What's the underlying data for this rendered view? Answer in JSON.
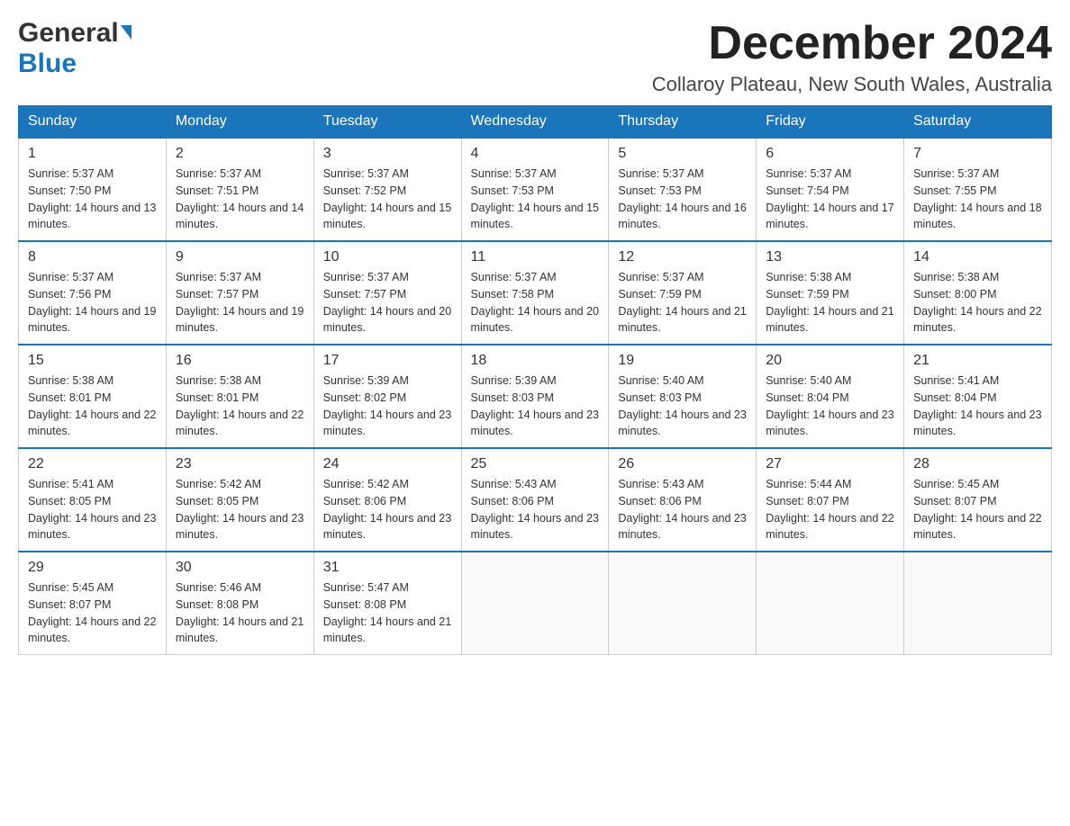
{
  "header": {
    "logo_general": "General",
    "logo_blue": "Blue",
    "month_title": "December 2024",
    "location": "Collaroy Plateau, New South Wales, Australia"
  },
  "calendar": {
    "days_of_week": [
      "Sunday",
      "Monday",
      "Tuesday",
      "Wednesday",
      "Thursday",
      "Friday",
      "Saturday"
    ],
    "weeks": [
      [
        {
          "day": "1",
          "sunrise": "Sunrise: 5:37 AM",
          "sunset": "Sunset: 7:50 PM",
          "daylight": "Daylight: 14 hours and 13 minutes."
        },
        {
          "day": "2",
          "sunrise": "Sunrise: 5:37 AM",
          "sunset": "Sunset: 7:51 PM",
          "daylight": "Daylight: 14 hours and 14 minutes."
        },
        {
          "day": "3",
          "sunrise": "Sunrise: 5:37 AM",
          "sunset": "Sunset: 7:52 PM",
          "daylight": "Daylight: 14 hours and 15 minutes."
        },
        {
          "day": "4",
          "sunrise": "Sunrise: 5:37 AM",
          "sunset": "Sunset: 7:53 PM",
          "daylight": "Daylight: 14 hours and 15 minutes."
        },
        {
          "day": "5",
          "sunrise": "Sunrise: 5:37 AM",
          "sunset": "Sunset: 7:53 PM",
          "daylight": "Daylight: 14 hours and 16 minutes."
        },
        {
          "day": "6",
          "sunrise": "Sunrise: 5:37 AM",
          "sunset": "Sunset: 7:54 PM",
          "daylight": "Daylight: 14 hours and 17 minutes."
        },
        {
          "day": "7",
          "sunrise": "Sunrise: 5:37 AM",
          "sunset": "Sunset: 7:55 PM",
          "daylight": "Daylight: 14 hours and 18 minutes."
        }
      ],
      [
        {
          "day": "8",
          "sunrise": "Sunrise: 5:37 AM",
          "sunset": "Sunset: 7:56 PM",
          "daylight": "Daylight: 14 hours and 19 minutes."
        },
        {
          "day": "9",
          "sunrise": "Sunrise: 5:37 AM",
          "sunset": "Sunset: 7:57 PM",
          "daylight": "Daylight: 14 hours and 19 minutes."
        },
        {
          "day": "10",
          "sunrise": "Sunrise: 5:37 AM",
          "sunset": "Sunset: 7:57 PM",
          "daylight": "Daylight: 14 hours and 20 minutes."
        },
        {
          "day": "11",
          "sunrise": "Sunrise: 5:37 AM",
          "sunset": "Sunset: 7:58 PM",
          "daylight": "Daylight: 14 hours and 20 minutes."
        },
        {
          "day": "12",
          "sunrise": "Sunrise: 5:37 AM",
          "sunset": "Sunset: 7:59 PM",
          "daylight": "Daylight: 14 hours and 21 minutes."
        },
        {
          "day": "13",
          "sunrise": "Sunrise: 5:38 AM",
          "sunset": "Sunset: 7:59 PM",
          "daylight": "Daylight: 14 hours and 21 minutes."
        },
        {
          "day": "14",
          "sunrise": "Sunrise: 5:38 AM",
          "sunset": "Sunset: 8:00 PM",
          "daylight": "Daylight: 14 hours and 22 minutes."
        }
      ],
      [
        {
          "day": "15",
          "sunrise": "Sunrise: 5:38 AM",
          "sunset": "Sunset: 8:01 PM",
          "daylight": "Daylight: 14 hours and 22 minutes."
        },
        {
          "day": "16",
          "sunrise": "Sunrise: 5:38 AM",
          "sunset": "Sunset: 8:01 PM",
          "daylight": "Daylight: 14 hours and 22 minutes."
        },
        {
          "day": "17",
          "sunrise": "Sunrise: 5:39 AM",
          "sunset": "Sunset: 8:02 PM",
          "daylight": "Daylight: 14 hours and 23 minutes."
        },
        {
          "day": "18",
          "sunrise": "Sunrise: 5:39 AM",
          "sunset": "Sunset: 8:03 PM",
          "daylight": "Daylight: 14 hours and 23 minutes."
        },
        {
          "day": "19",
          "sunrise": "Sunrise: 5:40 AM",
          "sunset": "Sunset: 8:03 PM",
          "daylight": "Daylight: 14 hours and 23 minutes."
        },
        {
          "day": "20",
          "sunrise": "Sunrise: 5:40 AM",
          "sunset": "Sunset: 8:04 PM",
          "daylight": "Daylight: 14 hours and 23 minutes."
        },
        {
          "day": "21",
          "sunrise": "Sunrise: 5:41 AM",
          "sunset": "Sunset: 8:04 PM",
          "daylight": "Daylight: 14 hours and 23 minutes."
        }
      ],
      [
        {
          "day": "22",
          "sunrise": "Sunrise: 5:41 AM",
          "sunset": "Sunset: 8:05 PM",
          "daylight": "Daylight: 14 hours and 23 minutes."
        },
        {
          "day": "23",
          "sunrise": "Sunrise: 5:42 AM",
          "sunset": "Sunset: 8:05 PM",
          "daylight": "Daylight: 14 hours and 23 minutes."
        },
        {
          "day": "24",
          "sunrise": "Sunrise: 5:42 AM",
          "sunset": "Sunset: 8:06 PM",
          "daylight": "Daylight: 14 hours and 23 minutes."
        },
        {
          "day": "25",
          "sunrise": "Sunrise: 5:43 AM",
          "sunset": "Sunset: 8:06 PM",
          "daylight": "Daylight: 14 hours and 23 minutes."
        },
        {
          "day": "26",
          "sunrise": "Sunrise: 5:43 AM",
          "sunset": "Sunset: 8:06 PM",
          "daylight": "Daylight: 14 hours and 23 minutes."
        },
        {
          "day": "27",
          "sunrise": "Sunrise: 5:44 AM",
          "sunset": "Sunset: 8:07 PM",
          "daylight": "Daylight: 14 hours and 22 minutes."
        },
        {
          "day": "28",
          "sunrise": "Sunrise: 5:45 AM",
          "sunset": "Sunset: 8:07 PM",
          "daylight": "Daylight: 14 hours and 22 minutes."
        }
      ],
      [
        {
          "day": "29",
          "sunrise": "Sunrise: 5:45 AM",
          "sunset": "Sunset: 8:07 PM",
          "daylight": "Daylight: 14 hours and 22 minutes."
        },
        {
          "day": "30",
          "sunrise": "Sunrise: 5:46 AM",
          "sunset": "Sunset: 8:08 PM",
          "daylight": "Daylight: 14 hours and 21 minutes."
        },
        {
          "day": "31",
          "sunrise": "Sunrise: 5:47 AM",
          "sunset": "Sunset: 8:08 PM",
          "daylight": "Daylight: 14 hours and 21 minutes."
        },
        null,
        null,
        null,
        null
      ]
    ]
  }
}
